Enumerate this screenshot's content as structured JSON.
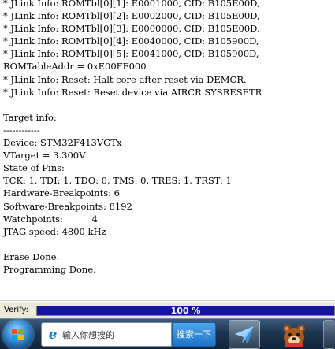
{
  "log": {
    "lines": [
      "* JLink Info: ROMTbl[0][1]: E0001000, CID: B105E00D,",
      "* JLink Info: ROMTbl[0][2]: E0002000, CID: B105E00D,",
      "* JLink Info: ROMTbl[0][3]: E0000000, CID: B105E00D,",
      "* JLink Info: ROMTbl[0][4]: E0040000, CID: B105900D,",
      "* JLink Info: ROMTbl[0][5]: E0041000, CID: B105900D,",
      "ROMTableAddr = 0xE00FF000",
      "* JLink Info: Reset: Halt core after reset via DEMCR.",
      "* JLink Info: Reset: Reset device via AIRCR.SYSRESETR",
      "",
      "Target info:",
      "------------",
      "Device: STM32F413VGTx",
      "VTarget = 3.300V",
      "State of Pins:",
      "TCK: 1, TDI: 1, TDO: 0, TMS: 0, TRES: 1, TRST: 1",
      "Hardware-Breakpoints: 6",
      "Software-Breakpoints: 8192",
      "Watchpoints:          4",
      "JTAG speed: 4800 kHz",
      "",
      "Erase Done.",
      "Programming Done."
    ]
  },
  "status": {
    "label": "Verify:",
    "progress_text": "100 %",
    "progress_fraction": 1.0,
    "progress_color": "#1515a3"
  },
  "taskbar": {
    "start_icon": "windows-logo-icon",
    "search": {
      "browser_icon": "ie-browser-icon",
      "placeholder": "输入你想搜的",
      "button_label": "搜索一下"
    },
    "apps": [
      {
        "icon": "paper-plane-app-icon"
      },
      {
        "icon": "bear-app-icon"
      },
      {
        "icon": "app-icon"
      }
    ]
  }
}
